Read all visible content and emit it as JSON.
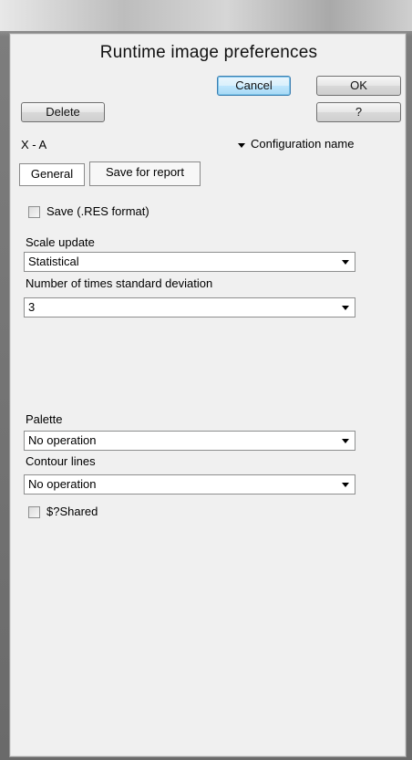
{
  "dialog": {
    "title": "Runtime image preferences",
    "buttons": {
      "cancel": "Cancel",
      "ok": "OK",
      "delete": "Delete",
      "help": "?"
    },
    "configuration": {
      "value": "X - A",
      "label": "Configuration name"
    },
    "tabs": [
      {
        "label": "General",
        "active": true
      },
      {
        "label": "Save for report",
        "active": false
      }
    ],
    "save_res": {
      "label": "Save (.RES format)",
      "checked": false
    },
    "scale_update": {
      "label": "Scale update",
      "value": "Statistical"
    },
    "std_dev": {
      "label": "Number of times standard deviation",
      "value": "3"
    },
    "palette": {
      "label": "Palette",
      "value": "No operation"
    },
    "contour_lines": {
      "label": "Contour lines",
      "value": "No operation"
    },
    "shared": {
      "label": "$?Shared",
      "checked": false
    }
  }
}
